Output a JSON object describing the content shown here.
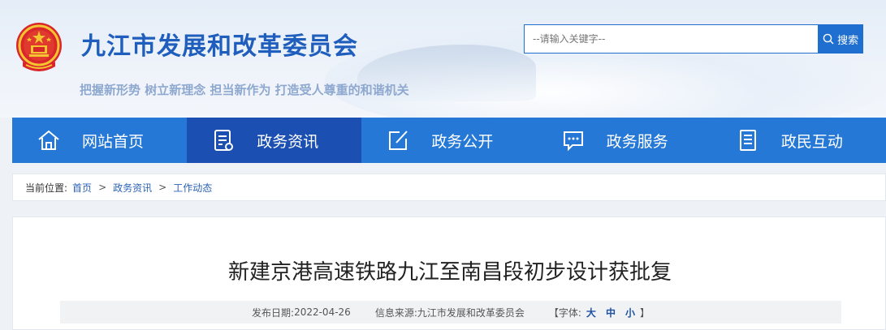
{
  "header": {
    "site_title": "九江市发展和改革委员会",
    "slogan": "把握新形势 树立新理念 担当新作为 打造受人尊重的和谐机关"
  },
  "search": {
    "placeholder": "--请输入关键字--",
    "button_label": "搜索"
  },
  "nav": {
    "items": [
      {
        "label": "网站首页",
        "icon": "home-icon"
      },
      {
        "label": "政务资讯",
        "icon": "document-icon",
        "active": true
      },
      {
        "label": "政务公开",
        "icon": "edit-icon"
      },
      {
        "label": "政务服务",
        "icon": "chat-icon"
      },
      {
        "label": "政民互动",
        "icon": "notes-icon"
      }
    ]
  },
  "breadcrumb": {
    "prefix": "当前位置:",
    "items": [
      "首页",
      "政务资讯",
      "工作动态"
    ],
    "separator": ">"
  },
  "article": {
    "title": "新建京港高速铁路九江至南昌段初步设计获批复",
    "publish_label": "发布日期:",
    "publish_date": "2022-04-26",
    "source_label": "信息来源:",
    "source": "九江市发展和改革委员会",
    "font_label": "【字体:",
    "font_sizes": [
      "大",
      "中",
      "小"
    ],
    "font_close": "】"
  },
  "colors": {
    "brand_blue": "#1f5ebd",
    "nav_bg": "#2678d6",
    "nav_active": "#1b4fb1"
  }
}
